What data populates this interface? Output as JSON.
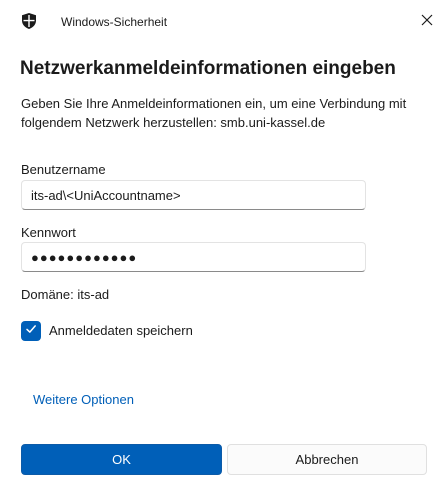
{
  "window": {
    "app_title": "Windows-Sicherheit",
    "icons": {
      "app": "shield-icon",
      "close": "close-icon"
    }
  },
  "dialog": {
    "heading": "Netzwerkanmeldeinformationen eingeben",
    "description": "Geben Sie Ihre Anmeldeinformationen ein, um eine Verbindung mit folgendem Netzwerk herzustellen: smb.uni-kassel.de"
  },
  "form": {
    "username": {
      "label": "Benutzername",
      "value": "its-ad\\<UniAccountname>"
    },
    "password": {
      "label": "Kennwort",
      "value": "●●●●●●●●●●●●"
    },
    "domain_text": "Domäne: its-ad",
    "remember": {
      "label": "Anmeldedaten speichern",
      "checked": true,
      "icon": "checkmark-icon"
    }
  },
  "links": {
    "more_options": "Weitere Optionen"
  },
  "buttons": {
    "ok": "OK",
    "cancel": "Abbrechen"
  },
  "colors": {
    "accent": "#005fb8",
    "text": "#1b1b1b",
    "background": "#ffffff"
  }
}
